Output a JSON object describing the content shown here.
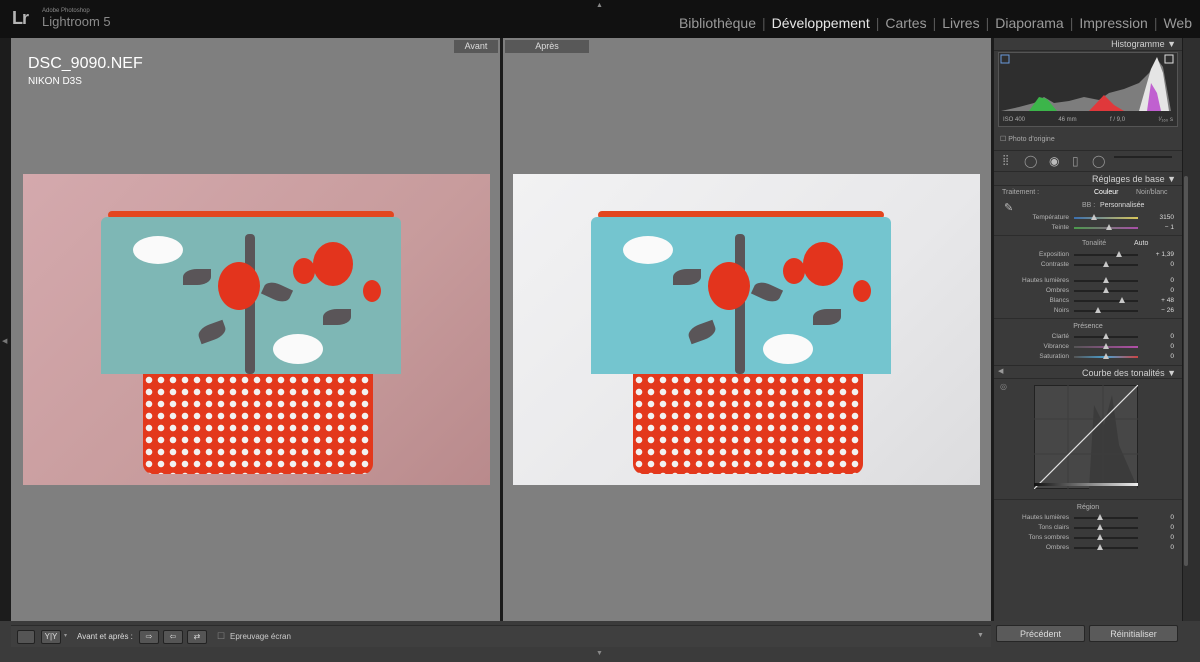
{
  "app": {
    "brand_line": "Adobe Photoshop",
    "name": "Lightroom 5",
    "logo": "Lr"
  },
  "modules": [
    {
      "label": "Bibliothèque",
      "active": false
    },
    {
      "label": "Développement",
      "active": true
    },
    {
      "label": "Cartes",
      "active": false
    },
    {
      "label": "Livres",
      "active": false
    },
    {
      "label": "Diaporama",
      "active": false
    },
    {
      "label": "Impression",
      "active": false
    },
    {
      "label": "Web",
      "active": false
    }
  ],
  "viewer": {
    "before_label": "Avant",
    "after_label": "Après",
    "filename": "DSC_9090.NEF",
    "camera": "NIKON D3S"
  },
  "histogram": {
    "title": "Histogramme",
    "iso": "ISO 400",
    "focal": "46 mm",
    "aperture": "f / 9,0",
    "shutter": "¹⁄₁₆₀ s",
    "original_photo": "Photo d'origine"
  },
  "basic": {
    "title": "Réglages de base",
    "treatment_label": "Traitement :",
    "color": "Couleur",
    "bw": "Noir/blanc",
    "wb_prefix": "BB :",
    "wb_value": "Personnalisée",
    "temperature": {
      "label": "Température",
      "value": "3150"
    },
    "tint": {
      "label": "Teinte",
      "value": "− 1"
    },
    "tone_label": "Tonalité",
    "auto": "Auto",
    "exposure": {
      "label": "Exposition",
      "value": "+ 1,39"
    },
    "contrast": {
      "label": "Contraste",
      "value": "0"
    },
    "highlights": {
      "label": "Hautes lumières",
      "value": "0"
    },
    "shadows": {
      "label": "Ombres",
      "value": "0"
    },
    "whites": {
      "label": "Blancs",
      "value": "+ 48"
    },
    "blacks": {
      "label": "Noirs",
      "value": "− 26"
    },
    "presence_label": "Présence",
    "clarity": {
      "label": "Clarté",
      "value": "0"
    },
    "vibrance": {
      "label": "Vibrance",
      "value": "0"
    },
    "saturation": {
      "label": "Saturation",
      "value": "0"
    }
  },
  "curve": {
    "title": "Courbe des tonalités",
    "region_label": "Région",
    "highlights": {
      "label": "Hautes lumières",
      "value": "0"
    },
    "lights": {
      "label": "Tons clairs",
      "value": "0"
    },
    "darks": {
      "label": "Tons sombres",
      "value": "0"
    },
    "shadows": {
      "label": "Ombres",
      "value": "0"
    }
  },
  "toolbar": {
    "before_after_label": "Avant et après :",
    "soft_proof": "Epreuvage écran",
    "yy": "Y|Y"
  },
  "buttons": {
    "previous": "Précédent",
    "reset": "Réinitialiser"
  },
  "colors": {
    "accent_active": "#e6e6e6",
    "panel_bg": "#3a3a3a",
    "viewer_bg": "#7f7f7f"
  }
}
